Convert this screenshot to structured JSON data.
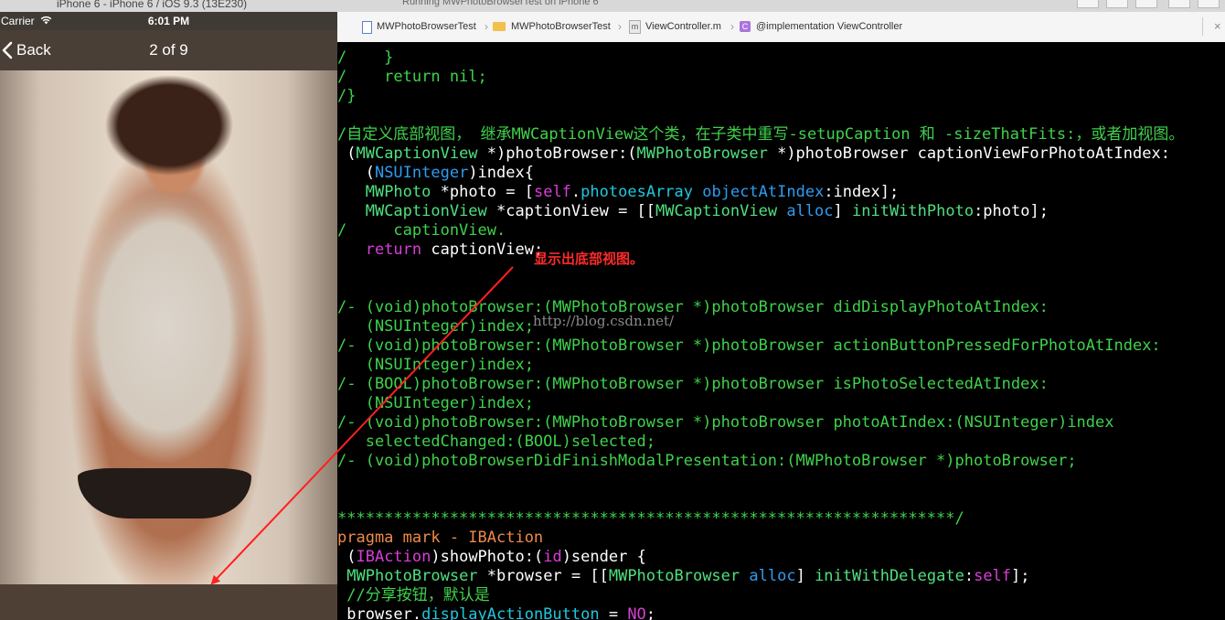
{
  "mac": {
    "simulator_title": "iPhone 6 - iPhone 6 / iOS 9.3 (13E230)",
    "run_status": "Running MWPhotoBrowserTest on iPhone 6"
  },
  "phone": {
    "statusbar": {
      "carrier": "Carrier",
      "time": "6:01 PM"
    },
    "navbar": {
      "back_label": "Back",
      "title": "2 of 9"
    }
  },
  "jumpbar": {
    "items": [
      "MWPhotoBrowserTest",
      "MWPhotoBrowserTest",
      "ViewController.m",
      "@implementation ViewController"
    ],
    "close_label": "×"
  },
  "code_lines": [
    [
      [
        "c-cm",
        "/    }"
      ]
    ],
    [
      [
        "c-cm",
        "/    return nil;"
      ]
    ],
    [
      [
        "c-cm",
        "/}"
      ]
    ],
    [
      [
        "c-pl",
        ""
      ]
    ],
    [
      [
        "c-cm",
        "/自定义底部视图， 继承MWCaptionView这个类，在子类中重写-setupCaption 和 -sizeThatFits:，或者加视图。"
      ]
    ],
    [
      [
        "c-pl",
        " ("
      ],
      [
        "c-tl",
        "MWCaptionView"
      ],
      [
        "c-pl",
        " *)photoBrowser:("
      ],
      [
        "c-tl",
        "MWPhotoBrowser"
      ],
      [
        "c-pl",
        " *)photoBrowser captionViewForPhotoAtIndex:"
      ]
    ],
    [
      [
        "c-pl",
        "   ("
      ],
      [
        "c-ty",
        "NSUInteger"
      ],
      [
        "c-pl",
        ")index{"
      ]
    ],
    [
      [
        "c-pl",
        "   "
      ],
      [
        "c-tl",
        "MWPhoto"
      ],
      [
        "c-pl",
        " *photo = ["
      ],
      [
        "c-kw",
        "self"
      ],
      [
        "c-pl",
        "."
      ],
      [
        "c-cy",
        "photoesArray"
      ],
      [
        "c-pl",
        " "
      ],
      [
        "c-ty",
        "objectAtIndex"
      ],
      [
        "c-pl",
        ":index];"
      ]
    ],
    [
      [
        "c-pl",
        "   "
      ],
      [
        "c-tl",
        "MWCaptionView"
      ],
      [
        "c-pl",
        " *captionView = [["
      ],
      [
        "c-tl",
        "MWCaptionView"
      ],
      [
        "c-pl",
        " "
      ],
      [
        "c-ty",
        "alloc"
      ],
      [
        "c-pl",
        "] "
      ],
      [
        "c-tl",
        "initWithPhoto"
      ],
      [
        "c-pl",
        ":photo];"
      ]
    ],
    [
      [
        "c-cm",
        "/     captionView."
      ]
    ],
    [
      [
        "c-pl",
        "   "
      ],
      [
        "c-kw",
        "return"
      ],
      [
        "c-pl",
        " captionView;"
      ]
    ],
    [
      [
        "c-pl",
        ""
      ]
    ],
    [
      [
        "c-pl",
        ""
      ]
    ],
    [
      [
        "c-cm",
        "/- (void)photoBrowser:(MWPhotoBrowser *)photoBrowser didDisplayPhotoAtIndex:"
      ]
    ],
    [
      [
        "c-cm",
        "   (NSUInteger)index;"
      ]
    ],
    [
      [
        "c-cm",
        "/- (void)photoBrowser:(MWPhotoBrowser *)photoBrowser actionButtonPressedForPhotoAtIndex:"
      ]
    ],
    [
      [
        "c-cm",
        "   (NSUInteger)index;"
      ]
    ],
    [
      [
        "c-cm",
        "/- (BOOL)photoBrowser:(MWPhotoBrowser *)photoBrowser isPhotoSelectedAtIndex:"
      ]
    ],
    [
      [
        "c-cm",
        "   (NSUInteger)index;"
      ]
    ],
    [
      [
        "c-cm",
        "/- (void)photoBrowser:(MWPhotoBrowser *)photoBrowser photoAtIndex:(NSUInteger)index"
      ]
    ],
    [
      [
        "c-cm",
        "   selectedChanged:(BOOL)selected;"
      ]
    ],
    [
      [
        "c-cm",
        "/- (void)photoBrowserDidFinishModalPresentation:(MWPhotoBrowser *)photoBrowser;"
      ]
    ],
    [
      [
        "c-pl",
        ""
      ]
    ],
    [
      [
        "c-pl",
        ""
      ]
    ],
    [
      [
        "c-cm",
        "******************************************************************/"
      ]
    ],
    [
      [
        "c-pr",
        "pragma mark - IBAction"
      ]
    ],
    [
      [
        "c-pl",
        " ("
      ],
      [
        "c-kw",
        "IBAction"
      ],
      [
        "c-pl",
        ")showPhoto:("
      ],
      [
        "c-kw",
        "id"
      ],
      [
        "c-pl",
        ")sender {"
      ]
    ],
    [
      [
        "c-pl",
        " "
      ],
      [
        "c-tl",
        "MWPhotoBrowser"
      ],
      [
        "c-pl",
        " *browser = [["
      ],
      [
        "c-tl",
        "MWPhotoBrowser"
      ],
      [
        "c-pl",
        " "
      ],
      [
        "c-ty",
        "alloc"
      ],
      [
        "c-pl",
        "] "
      ],
      [
        "c-tl",
        "initWithDelegate"
      ],
      [
        "c-pl",
        ":"
      ],
      [
        "c-kw",
        "self"
      ],
      [
        "c-pl",
        "];"
      ]
    ],
    [
      [
        "c-cm",
        " //分享按钮，默认是"
      ]
    ],
    [
      [
        "c-pl",
        " browser."
      ],
      [
        "c-cy",
        "displayActionButton"
      ],
      [
        "c-pl",
        " = "
      ],
      [
        "c-kw",
        "NO"
      ],
      [
        "c-pl",
        ";"
      ]
    ]
  ],
  "annotation": {
    "text": "显示出底部视图。",
    "color": "#ff2a2a"
  },
  "watermark": "http://blog.csdn.net/",
  "colors": {
    "comment": "#3fd24b",
    "keyword": "#d93ed7",
    "type": "#2e9cf1",
    "arrow": "#ff2020"
  }
}
